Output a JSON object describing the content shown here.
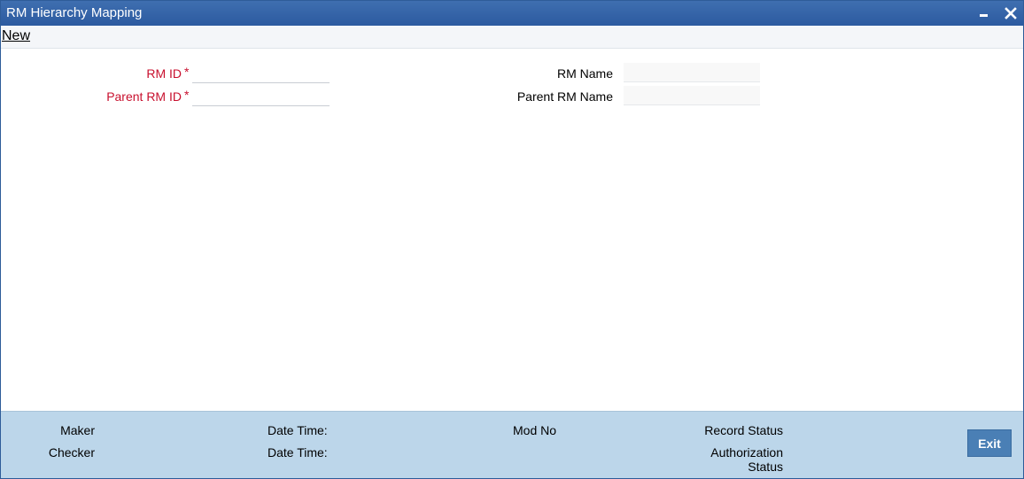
{
  "window": {
    "title": "RM Hierarchy Mapping"
  },
  "toolbar": {
    "new_label": "New"
  },
  "form": {
    "rm_id_label": "RM ID",
    "rm_id_value": "",
    "parent_rm_id_label": "Parent RM ID",
    "parent_rm_id_value": "",
    "required_marker": "*",
    "rm_name_label": "RM Name",
    "rm_name_value": "",
    "parent_rm_name_label": "Parent RM Name",
    "parent_rm_name_value": ""
  },
  "footer": {
    "maker_label": "Maker",
    "checker_label": "Checker",
    "maker_datetime_label": "Date Time:",
    "checker_datetime_label": "Date Time:",
    "mod_no_label": "Mod No",
    "record_status_label": "Record Status",
    "authorization_label": "Authorization",
    "status_label": "Status",
    "exit_label": "Exit"
  },
  "colors": {
    "titlebar": "#2c5aa0",
    "required_text": "#c8102e",
    "footer_bg": "#bcd6ea",
    "exit_button": "#4a7fb5"
  },
  "icons": {
    "minimize": "minimize-icon",
    "close": "close-icon"
  }
}
